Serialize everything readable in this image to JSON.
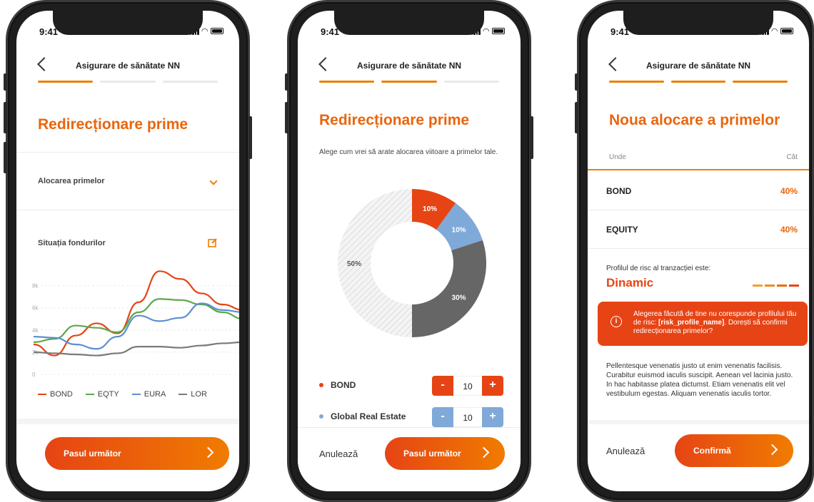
{
  "status": {
    "time": "9:41"
  },
  "screen1": {
    "header_title": "Asigurare de sănătate NN",
    "title": "Redirecționare prime",
    "alloc_label": "Alocarea primelor",
    "funds_label": "Situația fondurilor",
    "legend": [
      "BOND",
      "EQTY",
      "EURA",
      "LOR"
    ],
    "cta": "Pasul următor"
  },
  "chart_data": {
    "type": "line",
    "x": [
      0,
      1,
      2,
      3,
      4,
      5,
      6,
      7,
      8,
      9,
      10
    ],
    "ylabel": "",
    "yticks": [
      "0",
      "2k",
      "4k",
      "6k",
      "8k"
    ],
    "ylim": [
      0,
      9000
    ],
    "grid": true,
    "legend_position": "bottom",
    "series": [
      {
        "name": "BOND",
        "color": "#e64415",
        "values": [
          2700,
          1700,
          3500,
          4600,
          3700,
          6500,
          9300,
          8600,
          7300,
          6300,
          5800
        ]
      },
      {
        "name": "EQTY",
        "color": "#5ba84c",
        "values": [
          2900,
          3200,
          4400,
          4200,
          3800,
          5600,
          6800,
          6700,
          6300,
          5600,
          5000
        ]
      },
      {
        "name": "EURA",
        "color": "#5b8fd1",
        "values": [
          3400,
          3300,
          2700,
          2300,
          3400,
          5300,
          4800,
          5100,
          6400,
          5800,
          5600
        ]
      },
      {
        "name": "LOR",
        "color": "#7a7a7a",
        "values": [
          2000,
          1900,
          1800,
          1700,
          1900,
          2500,
          2500,
          2400,
          2600,
          2800,
          2900
        ]
      }
    ]
  },
  "screen2": {
    "header_title": "Asigurare de sănătate NN",
    "title": "Redirecționare prime",
    "description": "Alege cum vrei să arate alocarea viitoare a primelor tale.",
    "donut": [
      {
        "label": "10%",
        "value": 10,
        "color": "#e64415"
      },
      {
        "label": "10%",
        "value": 10,
        "color": "#7fa9d8"
      },
      {
        "label": "30%",
        "value": 30,
        "color": "#666666"
      },
      {
        "label": "50%",
        "value": 50,
        "color": "#ececec"
      }
    ],
    "funds": [
      {
        "name": "BOND",
        "value": "10",
        "color": "#e64415"
      },
      {
        "name": "Global Real Estate",
        "value": "10",
        "color": "#7fa9d8"
      }
    ],
    "minus": "-",
    "plus": "+",
    "cancel": "Anulează",
    "cta": "Pasul următor"
  },
  "screen3": {
    "header_title": "Asigurare de sănătate NN",
    "title": "Noua alocare a primelor",
    "col_where": "Unde",
    "col_amount": "Cât",
    "rows": [
      {
        "name": "BOND",
        "pct": "40%"
      },
      {
        "name": "EQUITY",
        "pct": "40%"
      }
    ],
    "risk_label": "Profilul de risc al tranzacției este:",
    "risk_value": "Dinamic",
    "warning_1": "Alegerea făcută de tine nu corespunde profilului tău de risc: ",
    "warning_bold": "[risk_profile_name]",
    "warning_2": ". Dorești să confirmi redirecționarea primelor?",
    "info_icon": "i",
    "paragraph": "Pellentesque venenatis justo ut enim venenatis facilisis. Curabitur euismod iaculis suscipit. Aenean vel lacinia justo. In hac habitasse platea dictumst. Etiam venenatis elit vel vestibulum egestas. Aliquam venenatis iaculis tortor.",
    "cancel": "Anulează",
    "cta": "Confirmă"
  },
  "colors": {
    "accent": "#ea650d",
    "gradient_start": "#e64415",
    "gradient_end": "#f07c00"
  }
}
